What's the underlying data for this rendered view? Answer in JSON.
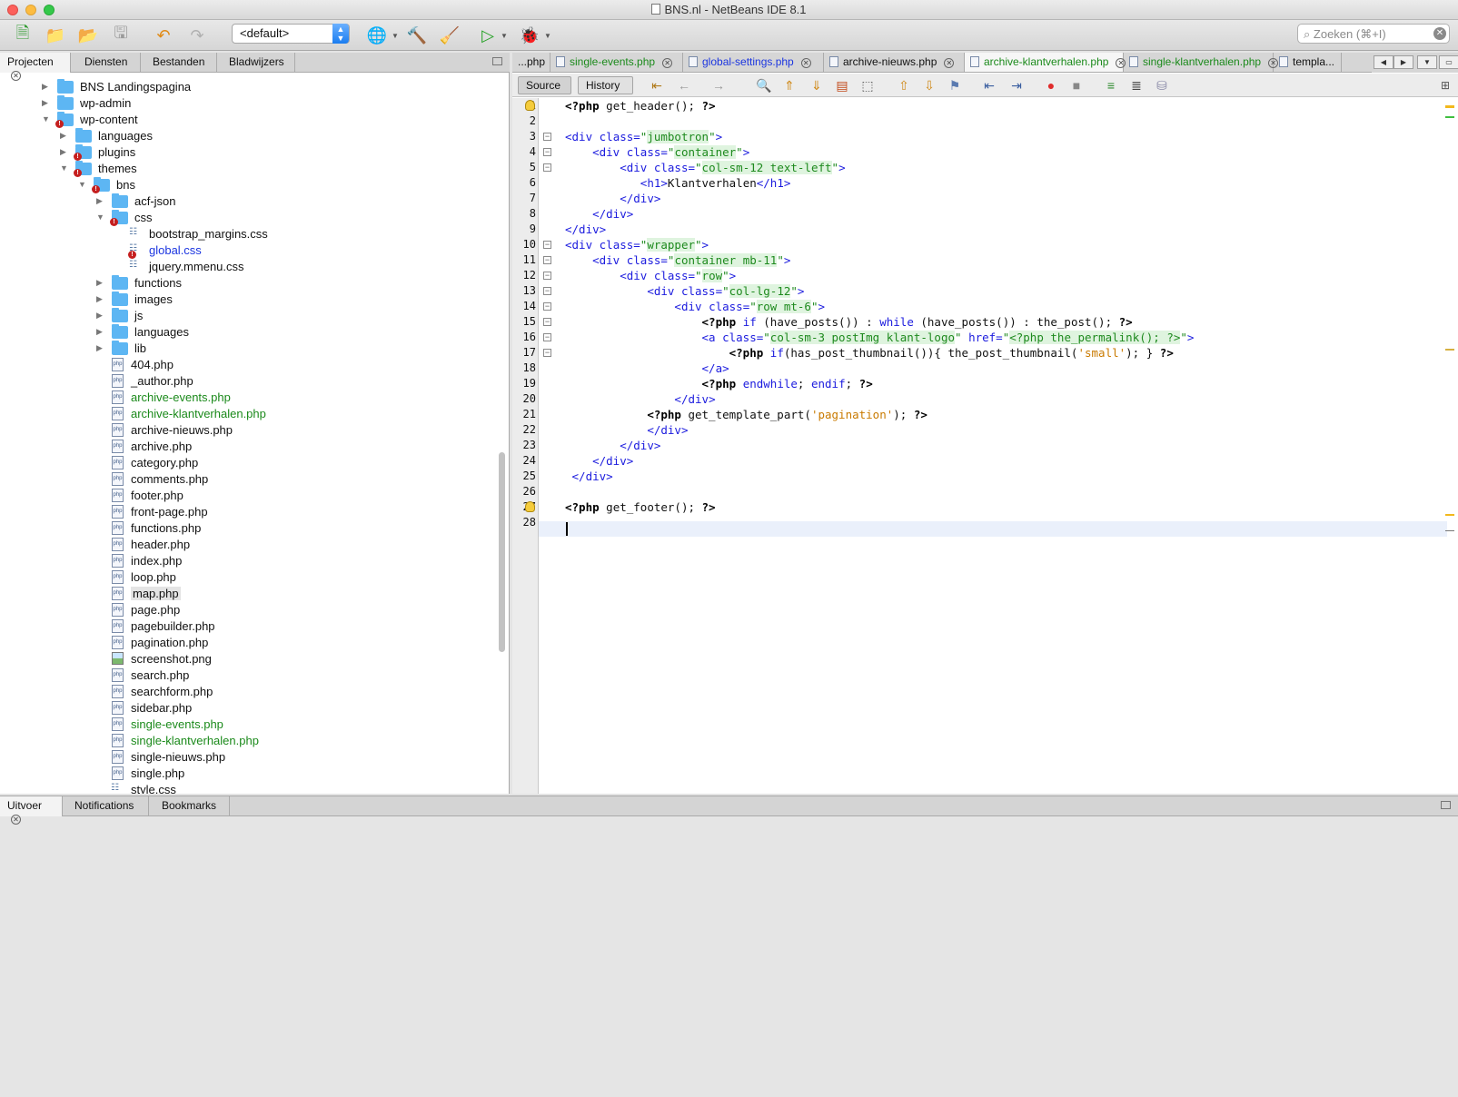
{
  "window": {
    "title": "BNS.nl - NetBeans IDE 8.1"
  },
  "toolbar": {
    "config_value": "<default>",
    "search_placeholder": "Zoeken (⌘+I)"
  },
  "left_panel": {
    "tabs": [
      {
        "label": "Projecten",
        "active": true
      },
      {
        "label": "Diensten"
      },
      {
        "label": "Bestanden"
      },
      {
        "label": "Bladwijzers"
      }
    ],
    "tree": [
      {
        "label": "BNS Landingspagina",
        "type": "folder",
        "depth": 0,
        "state": "collapsed"
      },
      {
        "label": "wp-admin",
        "type": "folder",
        "depth": 0,
        "state": "collapsed"
      },
      {
        "label": "wp-content",
        "type": "folder",
        "depth": 0,
        "state": "expanded",
        "error": true
      },
      {
        "label": "languages",
        "type": "folder",
        "depth": 1,
        "state": "collapsed"
      },
      {
        "label": "plugins",
        "type": "folder",
        "depth": 1,
        "state": "collapsed",
        "error": true
      },
      {
        "label": "themes",
        "type": "folder",
        "depth": 1,
        "state": "expanded",
        "error": true
      },
      {
        "label": "bns",
        "type": "folder",
        "depth": 2,
        "state": "expanded",
        "error": true
      },
      {
        "label": "acf-json",
        "type": "folder",
        "depth": 3,
        "state": "collapsed"
      },
      {
        "label": "css",
        "type": "folder",
        "depth": 3,
        "state": "expanded",
        "error": true
      },
      {
        "label": "bootstrap_margins.css",
        "type": "css",
        "depth": 4
      },
      {
        "label": "global.css",
        "type": "css",
        "depth": 4,
        "color": "blue",
        "error": true
      },
      {
        "label": "jquery.mmenu.css",
        "type": "css",
        "depth": 4
      },
      {
        "label": "functions",
        "type": "folder",
        "depth": 3,
        "state": "collapsed"
      },
      {
        "label": "images",
        "type": "folder",
        "depth": 3,
        "state": "collapsed"
      },
      {
        "label": "js",
        "type": "folder",
        "depth": 3,
        "state": "collapsed"
      },
      {
        "label": "languages",
        "type": "folder",
        "depth": 3,
        "state": "collapsed"
      },
      {
        "label": "lib",
        "type": "folder",
        "depth": 3,
        "state": "collapsed"
      },
      {
        "label": "404.php",
        "type": "php",
        "depth": 3
      },
      {
        "label": "_author.php",
        "type": "php",
        "depth": 3
      },
      {
        "label": "archive-events.php",
        "type": "php",
        "depth": 3,
        "color": "green"
      },
      {
        "label": "archive-klantverhalen.php",
        "type": "php",
        "depth": 3,
        "color": "green"
      },
      {
        "label": "archive-nieuws.php",
        "type": "php",
        "depth": 3
      },
      {
        "label": "archive.php",
        "type": "php",
        "depth": 3
      },
      {
        "label": "category.php",
        "type": "php",
        "depth": 3
      },
      {
        "label": "comments.php",
        "type": "php",
        "depth": 3
      },
      {
        "label": "footer.php",
        "type": "php",
        "depth": 3
      },
      {
        "label": "front-page.php",
        "type": "php",
        "depth": 3
      },
      {
        "label": "functions.php",
        "type": "php",
        "depth": 3
      },
      {
        "label": "header.php",
        "type": "php",
        "depth": 3
      },
      {
        "label": "index.php",
        "type": "php",
        "depth": 3
      },
      {
        "label": "loop.php",
        "type": "php",
        "depth": 3
      },
      {
        "label": "map.php",
        "type": "php",
        "depth": 3,
        "selected": true
      },
      {
        "label": "page.php",
        "type": "php",
        "depth": 3
      },
      {
        "label": "pagebuilder.php",
        "type": "php",
        "depth": 3
      },
      {
        "label": "pagination.php",
        "type": "php",
        "depth": 3
      },
      {
        "label": "screenshot.png",
        "type": "image",
        "depth": 3
      },
      {
        "label": "search.php",
        "type": "php",
        "depth": 3
      },
      {
        "label": "searchform.php",
        "type": "php",
        "depth": 3
      },
      {
        "label": "sidebar.php",
        "type": "php",
        "depth": 3
      },
      {
        "label": "single-events.php",
        "type": "php",
        "depth": 3,
        "color": "green"
      },
      {
        "label": "single-klantverhalen.php",
        "type": "php",
        "depth": 3,
        "color": "green"
      },
      {
        "label": "single-nieuws.php",
        "type": "php",
        "depth": 3
      },
      {
        "label": "single.php",
        "type": "php",
        "depth": 3
      },
      {
        "label": "style.css",
        "type": "css",
        "depth": 3
      }
    ]
  },
  "editor": {
    "tabs": [
      {
        "label": "...php",
        "closable": false
      },
      {
        "label": "single-events.php",
        "color": "green"
      },
      {
        "label": "global-settings.php",
        "color": "blue"
      },
      {
        "label": "archive-nieuws.php"
      },
      {
        "label": "archive-klantverhalen.php",
        "color": "green",
        "active": true
      },
      {
        "label": "single-klantverhalen.php",
        "color": "green"
      },
      {
        "label": "templa..."
      }
    ],
    "view_buttons": {
      "source": "Source",
      "history": "History"
    },
    "lines": [
      "<?php get_header(); ?>",
      "",
      "<div class=\"jumbotron\">",
      "    <div class=\"container\">",
      "        <div class=\"col-sm-12 text-left\">",
      "           <h1>Klantverhalen</h1>",
      "        </div>",
      "    </div>",
      "</div>",
      "<div class=\"wrapper\">",
      "    <div class=\"container mb-11\">",
      "        <div class=\"row\">",
      "            <div class=\"col-lg-12\">",
      "                <div class=\"row mt-6\">",
      "                    <?php if (have_posts()) : while (have_posts()) : the_post(); ?>",
      "                    <a class=\"col-sm-3 postImg klant-logo\" href=\"<?php the_permalink(); ?>\">",
      "                        <?php if(has_post_thumbnail()){ the_post_thumbnail('small'); } ?>",
      "                    </a>",
      "                    <?php endwhile; endif; ?>",
      "                </div>",
      "            <?php get_template_part('pagination'); ?>",
      "            </div>",
      "        </div>",
      "    </div>",
      " </div>",
      "",
      "<?php get_footer(); ?>",
      ""
    ]
  },
  "bottom_panel": {
    "tabs": [
      {
        "label": "Uitvoer",
        "active": true
      },
      {
        "label": "Notifications"
      },
      {
        "label": "Bookmarks"
      }
    ]
  }
}
